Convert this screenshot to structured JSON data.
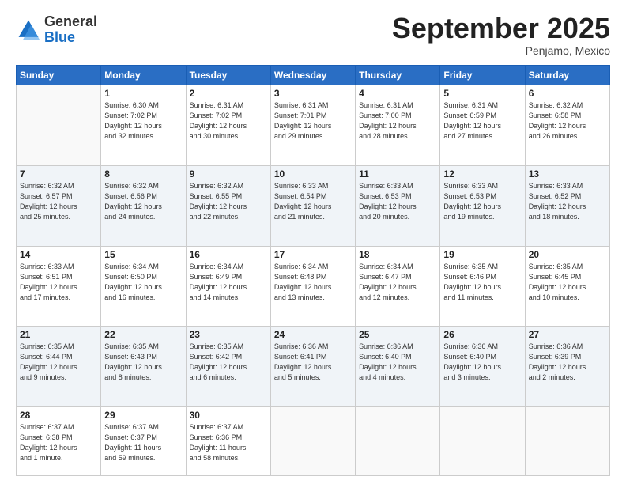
{
  "header": {
    "logo": {
      "general": "General",
      "blue": "Blue"
    },
    "title": "September 2025",
    "location": "Penjamo, Mexico"
  },
  "days_of_week": [
    "Sunday",
    "Monday",
    "Tuesday",
    "Wednesday",
    "Thursday",
    "Friday",
    "Saturday"
  ],
  "weeks": [
    [
      {
        "day": "",
        "info": ""
      },
      {
        "day": "1",
        "info": "Sunrise: 6:30 AM\nSunset: 7:02 PM\nDaylight: 12 hours\nand 32 minutes."
      },
      {
        "day": "2",
        "info": "Sunrise: 6:31 AM\nSunset: 7:02 PM\nDaylight: 12 hours\nand 30 minutes."
      },
      {
        "day": "3",
        "info": "Sunrise: 6:31 AM\nSunset: 7:01 PM\nDaylight: 12 hours\nand 29 minutes."
      },
      {
        "day": "4",
        "info": "Sunrise: 6:31 AM\nSunset: 7:00 PM\nDaylight: 12 hours\nand 28 minutes."
      },
      {
        "day": "5",
        "info": "Sunrise: 6:31 AM\nSunset: 6:59 PM\nDaylight: 12 hours\nand 27 minutes."
      },
      {
        "day": "6",
        "info": "Sunrise: 6:32 AM\nSunset: 6:58 PM\nDaylight: 12 hours\nand 26 minutes."
      }
    ],
    [
      {
        "day": "7",
        "info": "Sunrise: 6:32 AM\nSunset: 6:57 PM\nDaylight: 12 hours\nand 25 minutes."
      },
      {
        "day": "8",
        "info": "Sunrise: 6:32 AM\nSunset: 6:56 PM\nDaylight: 12 hours\nand 24 minutes."
      },
      {
        "day": "9",
        "info": "Sunrise: 6:32 AM\nSunset: 6:55 PM\nDaylight: 12 hours\nand 22 minutes."
      },
      {
        "day": "10",
        "info": "Sunrise: 6:33 AM\nSunset: 6:54 PM\nDaylight: 12 hours\nand 21 minutes."
      },
      {
        "day": "11",
        "info": "Sunrise: 6:33 AM\nSunset: 6:53 PM\nDaylight: 12 hours\nand 20 minutes."
      },
      {
        "day": "12",
        "info": "Sunrise: 6:33 AM\nSunset: 6:53 PM\nDaylight: 12 hours\nand 19 minutes."
      },
      {
        "day": "13",
        "info": "Sunrise: 6:33 AM\nSunset: 6:52 PM\nDaylight: 12 hours\nand 18 minutes."
      }
    ],
    [
      {
        "day": "14",
        "info": "Sunrise: 6:33 AM\nSunset: 6:51 PM\nDaylight: 12 hours\nand 17 minutes."
      },
      {
        "day": "15",
        "info": "Sunrise: 6:34 AM\nSunset: 6:50 PM\nDaylight: 12 hours\nand 16 minutes."
      },
      {
        "day": "16",
        "info": "Sunrise: 6:34 AM\nSunset: 6:49 PM\nDaylight: 12 hours\nand 14 minutes."
      },
      {
        "day": "17",
        "info": "Sunrise: 6:34 AM\nSunset: 6:48 PM\nDaylight: 12 hours\nand 13 minutes."
      },
      {
        "day": "18",
        "info": "Sunrise: 6:34 AM\nSunset: 6:47 PM\nDaylight: 12 hours\nand 12 minutes."
      },
      {
        "day": "19",
        "info": "Sunrise: 6:35 AM\nSunset: 6:46 PM\nDaylight: 12 hours\nand 11 minutes."
      },
      {
        "day": "20",
        "info": "Sunrise: 6:35 AM\nSunset: 6:45 PM\nDaylight: 12 hours\nand 10 minutes."
      }
    ],
    [
      {
        "day": "21",
        "info": "Sunrise: 6:35 AM\nSunset: 6:44 PM\nDaylight: 12 hours\nand 9 minutes."
      },
      {
        "day": "22",
        "info": "Sunrise: 6:35 AM\nSunset: 6:43 PM\nDaylight: 12 hours\nand 8 minutes."
      },
      {
        "day": "23",
        "info": "Sunrise: 6:35 AM\nSunset: 6:42 PM\nDaylight: 12 hours\nand 6 minutes."
      },
      {
        "day": "24",
        "info": "Sunrise: 6:36 AM\nSunset: 6:41 PM\nDaylight: 12 hours\nand 5 minutes."
      },
      {
        "day": "25",
        "info": "Sunrise: 6:36 AM\nSunset: 6:40 PM\nDaylight: 12 hours\nand 4 minutes."
      },
      {
        "day": "26",
        "info": "Sunrise: 6:36 AM\nSunset: 6:40 PM\nDaylight: 12 hours\nand 3 minutes."
      },
      {
        "day": "27",
        "info": "Sunrise: 6:36 AM\nSunset: 6:39 PM\nDaylight: 12 hours\nand 2 minutes."
      }
    ],
    [
      {
        "day": "28",
        "info": "Sunrise: 6:37 AM\nSunset: 6:38 PM\nDaylight: 12 hours\nand 1 minute."
      },
      {
        "day": "29",
        "info": "Sunrise: 6:37 AM\nSunset: 6:37 PM\nDaylight: 11 hours\nand 59 minutes."
      },
      {
        "day": "30",
        "info": "Sunrise: 6:37 AM\nSunset: 6:36 PM\nDaylight: 11 hours\nand 58 minutes."
      },
      {
        "day": "",
        "info": ""
      },
      {
        "day": "",
        "info": ""
      },
      {
        "day": "",
        "info": ""
      },
      {
        "day": "",
        "info": ""
      }
    ]
  ]
}
